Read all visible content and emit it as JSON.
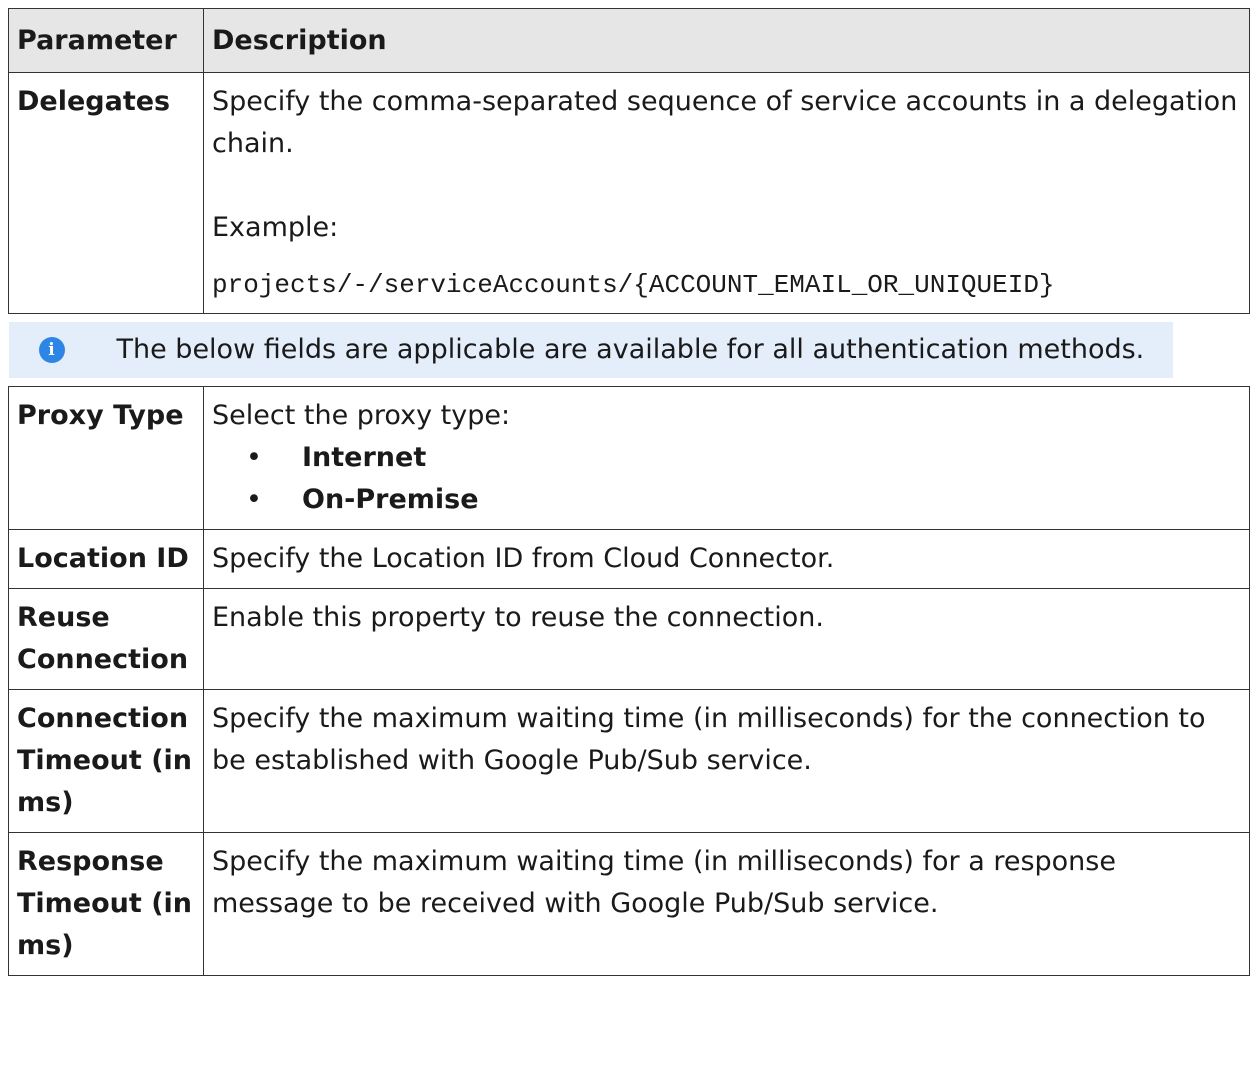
{
  "table": {
    "header": {
      "parameter": "Parameter",
      "description": "Description"
    },
    "delegates": {
      "name": "Delegates",
      "description": "Specify the comma-separated sequence of service accounts in a delegation chain.",
      "example_label": "Example:",
      "example_code": "projects/-/serviceAccounts/{ACCOUNT_EMAIL_OR_UNIQUEID}"
    },
    "note": {
      "icon": "info-icon",
      "text": "The below fields are applicable are available for all authentication methods."
    },
    "proxy_type": {
      "name": "Proxy Type",
      "description": "Select the proxy type:",
      "options": [
        "Internet",
        "On-Premise"
      ]
    },
    "location_id": {
      "name": "Location ID",
      "description": "Specify the Location ID from Cloud Connector."
    },
    "reuse_connection": {
      "name": "Reuse Connection",
      "description": "Enable this property to reuse the connection."
    },
    "connection_timeout": {
      "name": "Connection Timeout (in ms)",
      "description": "Specify the maximum waiting time (in milliseconds) for the connection to be established with Google Pub/Sub service."
    },
    "response_timeout": {
      "name": "Response Timeout (in ms)",
      "description": "Specify the maximum waiting time (in milliseconds) for a response message to be received with Google Pub/Sub service."
    }
  },
  "colors": {
    "header_bg": "#e6e6e6",
    "note_bg": "#e4eefa",
    "info_icon": "#2d86e6"
  }
}
